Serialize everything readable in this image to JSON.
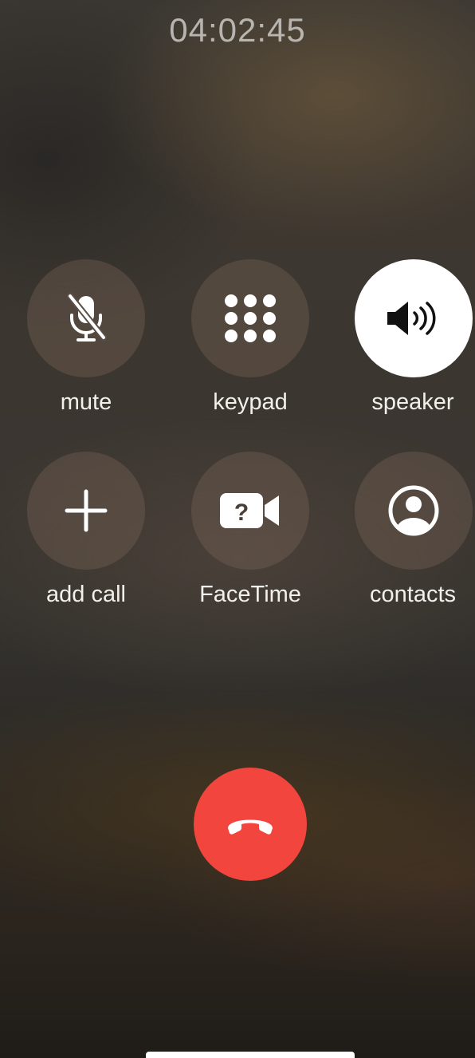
{
  "call": {
    "duration": "04:02:45"
  },
  "controls": [
    {
      "id": "mute",
      "label": "mute",
      "icon": "mic-slash-icon",
      "active": false
    },
    {
      "id": "keypad",
      "label": "keypad",
      "icon": "keypad-icon",
      "active": false
    },
    {
      "id": "speaker",
      "label": "speaker",
      "icon": "speaker-wave-icon",
      "active": true
    },
    {
      "id": "add-call",
      "label": "add call",
      "icon": "plus-icon",
      "active": false
    },
    {
      "id": "facetime",
      "label": "FaceTime",
      "icon": "video-camera-question-icon",
      "active": false
    },
    {
      "id": "contacts",
      "label": "contacts",
      "icon": "person-circle-icon",
      "active": false
    }
  ],
  "end_call": {
    "icon": "phone-down-icon",
    "color": "#F2453D"
  },
  "colors": {
    "end_call_red": "#F2453D",
    "active_button": "#FFFFFF",
    "label_text": "#F2F0EC"
  }
}
